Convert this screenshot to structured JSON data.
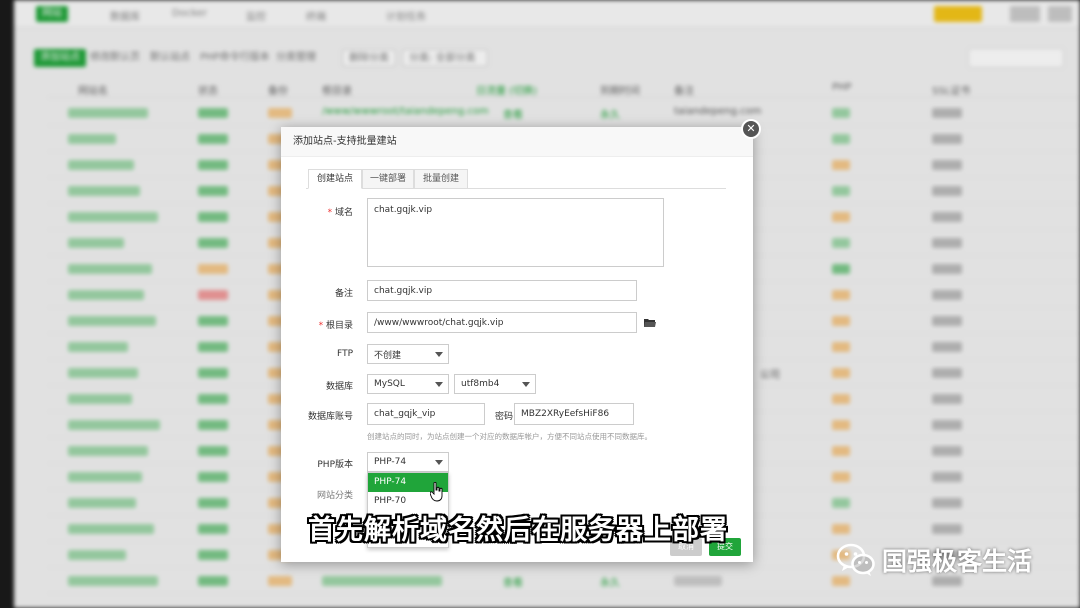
{
  "background": {
    "nav_labels": [
      "网站",
      "数据库",
      "Docker",
      "监控",
      "终端",
      "计划任务"
    ],
    "toolbar_labels": [
      "添加站点",
      "修改默认页",
      "默认站点",
      "PHP命令行版本",
      "分类管理"
    ],
    "toolbar_buttons": [
      "删除分类",
      "分类: 全部分类"
    ],
    "table_headers": [
      "网站名",
      "状态",
      "备份",
      "根目录",
      "日流量 (切换)",
      "到期时间",
      "备注",
      "PHP",
      "SSL证书"
    ],
    "first_row": {
      "root": "/www/wwwroot/taiandepeng.com",
      "traffic": "查看",
      "expire": "永久",
      "note": "taiandepeng.com"
    },
    "last_row": {
      "traffic": "查看",
      "expire": "永久"
    },
    "partial_note": "公司",
    "colors": {
      "brand_green": "#20a53a",
      "orange": "#f0ad4e",
      "red": "#e33"
    }
  },
  "dialog": {
    "title": "添加站点-支持批量建站",
    "close_icon": "close-icon",
    "tabs": [
      {
        "label": "创建站点",
        "active": true
      },
      {
        "label": "一键部署",
        "active": false
      },
      {
        "label": "批量创建",
        "active": false
      }
    ],
    "domain": {
      "label": "域名",
      "value": "chat.gqjk.vip"
    },
    "note": {
      "label": "备注",
      "value": "chat.gqjk.vip"
    },
    "root": {
      "label": "根目录",
      "value": "/www/wwwroot/chat.gqjk.vip",
      "icon": "folder-icon"
    },
    "ftp": {
      "label": "FTP",
      "value": "不创建"
    },
    "database": {
      "label": "数据库",
      "type": "MySQL",
      "charset": "utf8mb4"
    },
    "db_account": {
      "label": "数据库账号",
      "value": "chat_gqjk_vip",
      "password_label": "密码",
      "password": "MBZ2XRyEefsHiF86"
    },
    "db_hint": "创建站点的同时，为站点创建一个对应的数据库帐户，方便不同站点使用不同数据库。",
    "php": {
      "label": "PHP版本",
      "value": "PHP-74",
      "options": [
        "PHP-74",
        "PHP-70"
      ],
      "highlighted": 0
    },
    "category": {
      "label": "网站分类"
    },
    "buttons": {
      "close": "取消",
      "submit": "提交"
    }
  },
  "subtitle": "首先解析域名然后在服务器上部署",
  "watermark": {
    "icon": "wechat-icon",
    "text": "国强极客生活"
  }
}
